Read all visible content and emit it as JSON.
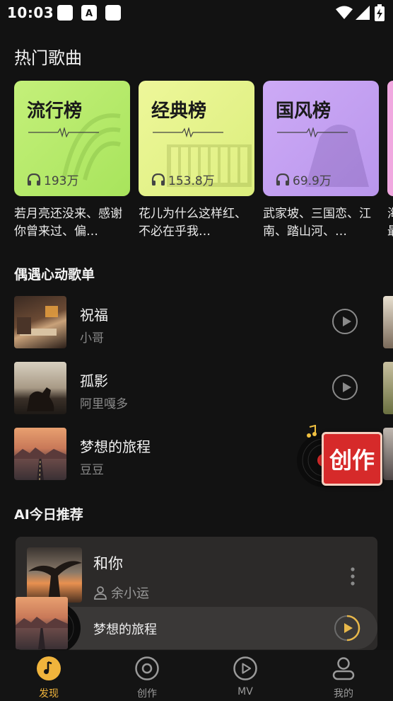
{
  "status_bar": {
    "time": "10:03"
  },
  "hot_songs": {
    "title": "热门歌曲",
    "charts": [
      {
        "name": "流行榜",
        "plays": "193万",
        "desc": "若月亮还没来、感谢你曾来过、偏…",
        "color": "#b8ec6a"
      },
      {
        "name": "经典榜",
        "plays": "153.8万",
        "desc": "花儿为什么这样红、不必在乎我…",
        "color": "#e5f38c"
      },
      {
        "name": "国风榜",
        "plays": "69.9万",
        "desc": "武家坡、三国恋、江南、踏山河、…",
        "color": "#c5a3f2"
      },
      {
        "name": "",
        "plays": "",
        "desc": "海最",
        "color": "#f0a8e0"
      }
    ]
  },
  "playlist_section": {
    "title": "偶遇心动歌单",
    "songs": [
      {
        "title": "祝福",
        "artist": "小哥"
      },
      {
        "title": "孤影",
        "artist": "阿里嘎多"
      },
      {
        "title": "梦想的旅程",
        "artist": "豆豆"
      }
    ]
  },
  "create_badge": {
    "label": "创作",
    "color": "#d62a2a"
  },
  "ai_section": {
    "title": "AI今日推荐",
    "song": {
      "title": "和你",
      "artist": "余小运"
    }
  },
  "mini_player": {
    "title": "梦想的旅程",
    "accent": "#e8b84a"
  },
  "tab_bar": {
    "active_color": "#f0b43c",
    "items": [
      {
        "label": "发现",
        "icon": "music-note-icon"
      },
      {
        "label": "创作",
        "icon": "record-icon"
      },
      {
        "label": "MV",
        "icon": "play-icon"
      },
      {
        "label": "我的",
        "icon": "user-icon"
      }
    ]
  }
}
